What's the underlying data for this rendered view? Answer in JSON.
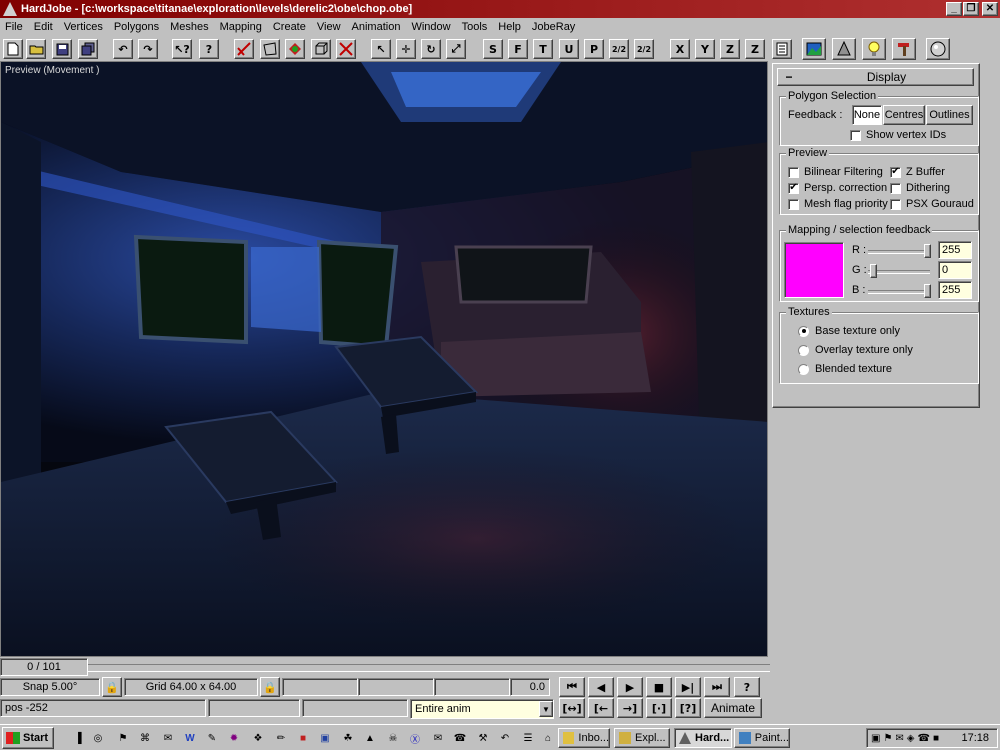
{
  "window": {
    "title": "HardJobe - [c:\\workspace\\titanae\\exploration\\levels\\derelic2\\obe\\chop.obe]"
  },
  "menu": [
    "File",
    "Edit",
    "Vertices",
    "Polygons",
    "Meshes",
    "Mapping",
    "Create",
    "View",
    "Animation",
    "Window",
    "Tools",
    "Help",
    "JobeRay"
  ],
  "toolbar": {
    "view_buttons": [
      "S",
      "F",
      "T",
      "U",
      "P",
      "2/2",
      "2/2"
    ],
    "axis_buttons": [
      "X",
      "Y",
      "Z",
      "Z"
    ]
  },
  "viewport": {
    "label": "Preview (Movement )"
  },
  "panel": {
    "title": "Display",
    "polygon_selection": {
      "title": "Polygon Selection",
      "feedback_label": "Feedback :",
      "buttons": [
        "None",
        "Centres",
        "Outlines"
      ],
      "show_vertex_ids": "Show vertex IDs"
    },
    "preview": {
      "title": "Preview",
      "options": [
        {
          "label": "Bilinear Filtering",
          "checked": false
        },
        {
          "label": "Z Buffer",
          "checked": true
        },
        {
          "label": "Persp. correction",
          "checked": true
        },
        {
          "label": "Dithering",
          "checked": false
        },
        {
          "label": "Mesh flag priority",
          "checked": false
        },
        {
          "label": "PSX Gouraud",
          "checked": false
        }
      ]
    },
    "mapping": {
      "title": "Mapping / selection feedback",
      "swatch_color": "#ff00ff",
      "r_label": "R :",
      "g_label": "G :",
      "b_label": "B :",
      "r": "255",
      "g": "0",
      "b": "255"
    },
    "textures": {
      "title": "Textures",
      "options": [
        "Base texture only",
        "Overlay texture only",
        "Blended texture"
      ],
      "selected": 0
    }
  },
  "frame": {
    "counter": "0 / 101"
  },
  "status": {
    "snap": "Snap 5.00°",
    "grid": "Grid 64.00 x 64.00",
    "value": "0.0",
    "pos": "pos -252",
    "anim_select": "Entire anim",
    "animate_button": "Animate",
    "help_button": "?"
  },
  "taskbar": {
    "start": "Start",
    "tasks": [
      "Inbo...",
      "Expl...",
      "Hard...",
      "Paint..."
    ],
    "clock": "17:18"
  }
}
